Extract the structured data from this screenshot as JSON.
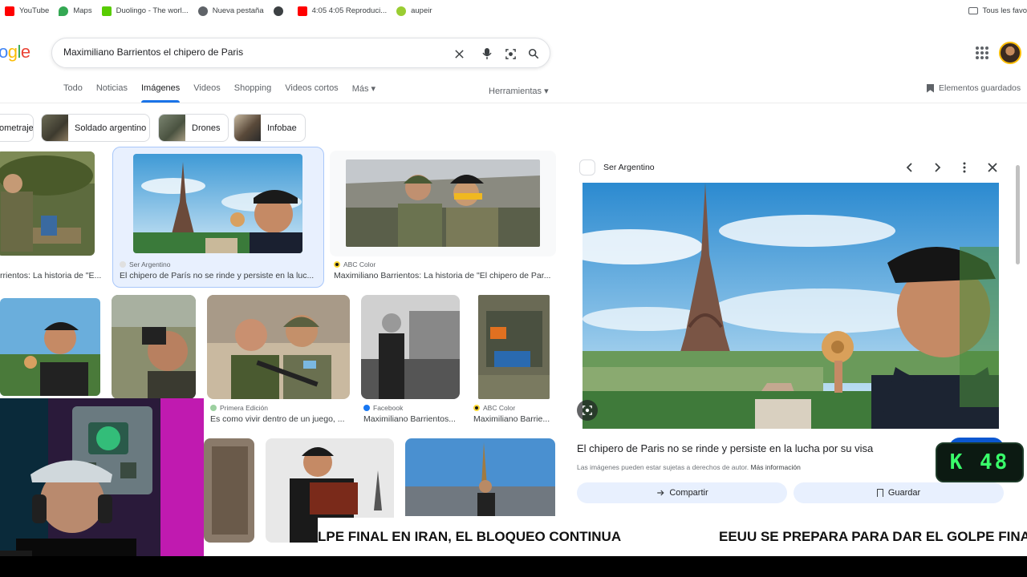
{
  "bookmarks": [
    {
      "label": "YouTube",
      "color": "#ff0000"
    },
    {
      "label": "Maps",
      "color": "#34a853"
    },
    {
      "label": "Duolingo - The worl...",
      "color": "#58cc02"
    },
    {
      "label": "Nueva pestaña",
      "color": "#5f6368"
    },
    {
      "label": "",
      "color": "#3c4043"
    },
    {
      "label": "4:05 4:05 Reproduci...",
      "color": "#ff0000"
    },
    {
      "label": "aupeir",
      "color": "#9acd32"
    }
  ],
  "bookmarks_right": "Tous les favo",
  "logo": "ogle",
  "search": {
    "query": "Maximiliano Barrientos el chipero de Paris"
  },
  "tabs": [
    "Todo",
    "Noticias",
    "Imágenes",
    "Videos",
    "Shopping",
    "Videos cortos",
    "Más ▾"
  ],
  "active_tab": "Imágenes",
  "tools_label": "Herramientas ▾",
  "saved_label": "Elementos guardados",
  "chips": [
    "ometraje",
    "Soldado argentino",
    "Drones",
    "Infobae"
  ],
  "results_row1": [
    {
      "source": "",
      "title": "rrientos: La historia de \"E..."
    },
    {
      "source": "Ser Argentino",
      "title": "El chipero de París no se rinde y persiste en la luc..."
    },
    {
      "source": "ABC Color",
      "title": "Maximiliano Barrientos: La historia de \"El chipero de Par..."
    }
  ],
  "results_row2": [
    {
      "source": "Primera Edición",
      "title": "Es como vivir dentro de un juego, ..."
    },
    {
      "source": "Facebook",
      "title": "Maximiliano Barrientos..."
    },
    {
      "source": "ABC Color",
      "title": "Maximiliano Barrie..."
    }
  ],
  "panel": {
    "source": "Ser Argentino",
    "title": "El chipero de Paris no se rinde y persiste en la lucha por su visa",
    "copyright": "Las imágenes pueden estar sujetas a derechos de autor.",
    "more_info": "Más información",
    "share_label": "Compartir",
    "save_label": "Guardar"
  },
  "overlay": {
    "counter": "K 48",
    "ticker_1": "LPE FINAL EN IRAN, EL BLOQUEO CONTINUA",
    "ticker_2": "EEUU SE PREPARA PARA DAR EL GOLPE FINAL E"
  },
  "colors": {
    "accent": "#1a73e8",
    "chip_border": "#dadce0",
    "counter_text": "#39ff6a"
  }
}
